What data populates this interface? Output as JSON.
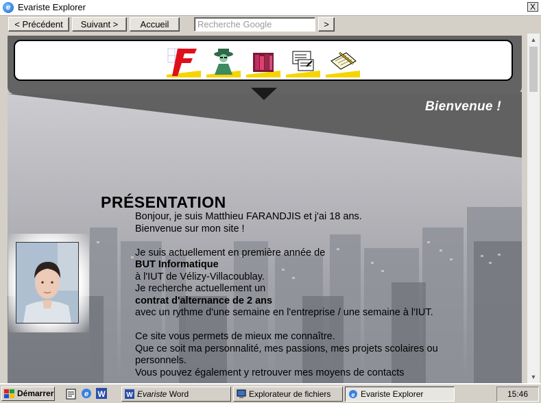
{
  "window": {
    "title": "Evariste Explorer",
    "close_label": "X"
  },
  "toolbar": {
    "back_label": "< Précédent",
    "forward_label": "Suivant >",
    "home_label": "Accueil",
    "search_placeholder": "Recherche Google",
    "go_label": ">"
  },
  "nav": {
    "icons": [
      "flash-icon",
      "agent-icon",
      "bookshelf-icon",
      "letter-icon",
      "notebook-icon"
    ]
  },
  "page": {
    "welcome": "Bienvenue !",
    "section_title": "PRÉSENTATION",
    "lines": [
      "Bonjour, je suis Matthieu FARANDJIS et j'ai 18 ans.",
      "Bienvenue sur mon site !",
      "",
      "Je suis actuellement en première année de",
      "BUT Informatique",
      "à l'IUT de Vélizy-Villacoublay.",
      "Je recherche actuellement un",
      "contrat d'alternance de 2 ans",
      "avec un rythme d'une semaine en l'entreprise / une semaine à l'IUT.",
      "",
      "Ce site vous permets de mieux me connaître.",
      "Que ce soit ma personnalité, mes passions, mes projets scolaires ou",
      "personnels.",
      "Vous pouvez également y retrouver mes moyens de contacts"
    ]
  },
  "taskbar": {
    "start_label": "Démarrer",
    "tasks": [
      {
        "label_a": "Evariste",
        "label_b": " Word"
      },
      {
        "label": "Explorateur de fichiers"
      },
      {
        "label": "Evariste Explorer"
      }
    ],
    "clock": "15:46"
  },
  "colors": {
    "accent_yellow": "#f5d400",
    "nav_band": "#636363",
    "title_bg": "#ffffff"
  }
}
